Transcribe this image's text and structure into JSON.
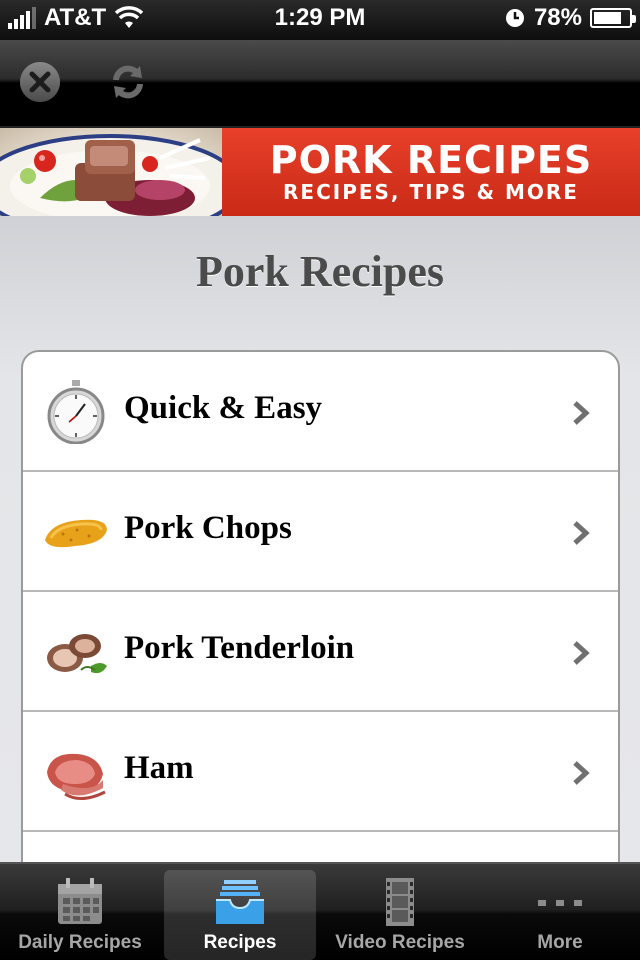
{
  "status": {
    "carrier": "AT&T",
    "time": "1:29 PM",
    "battery": "78%",
    "battery_level": 0.78
  },
  "banner": {
    "title": "PORK RECIPES",
    "subtitle": "RECIPES, TIPS & MORE"
  },
  "page": {
    "title": "Pork Recipes"
  },
  "items": [
    {
      "label": "Quick & Easy",
      "icon": "stopwatch-icon"
    },
    {
      "label": "Pork Chops",
      "icon": "pork-chop-icon"
    },
    {
      "label": "Pork Tenderloin",
      "icon": "tenderloin-icon"
    },
    {
      "label": "Ham",
      "icon": "ham-icon"
    }
  ],
  "tabs": [
    {
      "label": "Daily Recipes",
      "icon": "calendar-icon"
    },
    {
      "label": "Recipes",
      "icon": "inbox-tray-icon",
      "selected": true
    },
    {
      "label": "Video Recipes",
      "icon": "film-icon"
    },
    {
      "label": "More",
      "icon": "more-dots-icon"
    }
  ],
  "colors": {
    "banner_red": "#d9341f",
    "selected_tab_blue": "#3aa0e8"
  }
}
